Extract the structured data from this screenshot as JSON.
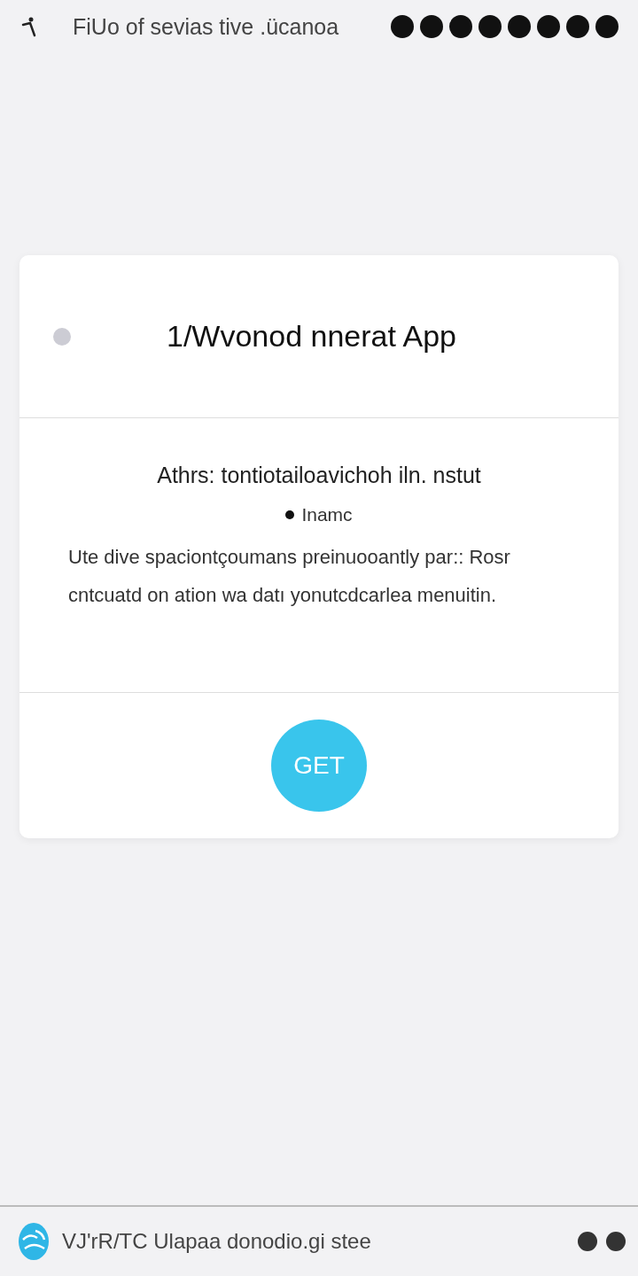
{
  "top_bar": {
    "title": "FiUo of sevias tive .ücanoa"
  },
  "card": {
    "title": "1/Wvonod nnerat App",
    "heading": "Athrs: tontiotailoavichoh iln. nstut",
    "bullets": [
      "Inamc"
    ],
    "paragraph": "Ute dive spaciontçoumans preinuooantly par:: Rosr cntcuatd on ation wa datı yonutcdcarlea menuitin.",
    "button": "GET"
  },
  "bottom_bar": {
    "text": "VJ'rR/TC Ulapaa donodio.gi stee"
  }
}
